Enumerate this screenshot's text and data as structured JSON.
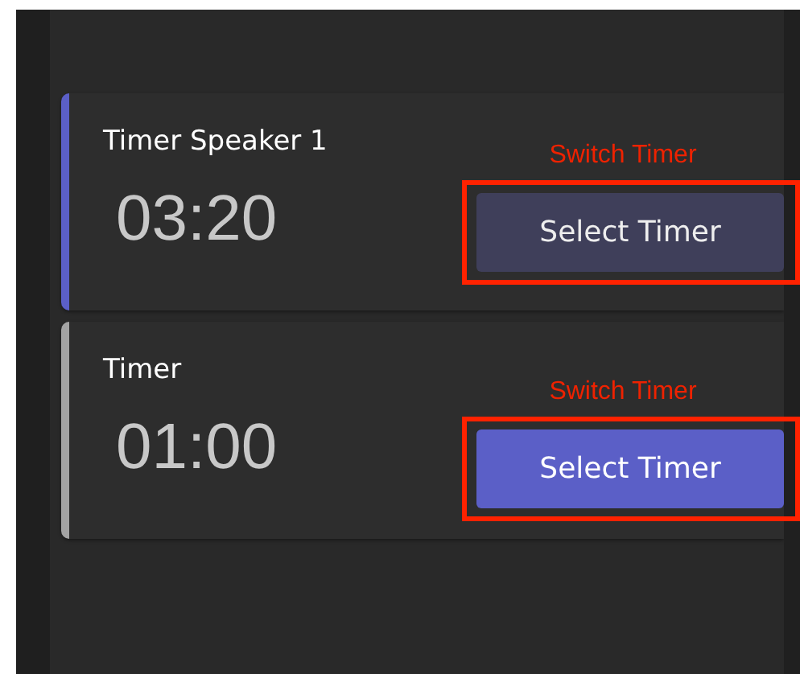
{
  "timers": [
    {
      "title": "Timer Speaker 1",
      "time": "03:20",
      "selected": true,
      "button": {
        "label": "Select Timer",
        "disabled": true
      },
      "annotation": "Switch Timer"
    },
    {
      "title": "Timer",
      "time": "01:00",
      "selected": false,
      "button": {
        "label": "Select Timer",
        "disabled": false
      },
      "annotation": "Switch Timer"
    }
  ]
}
